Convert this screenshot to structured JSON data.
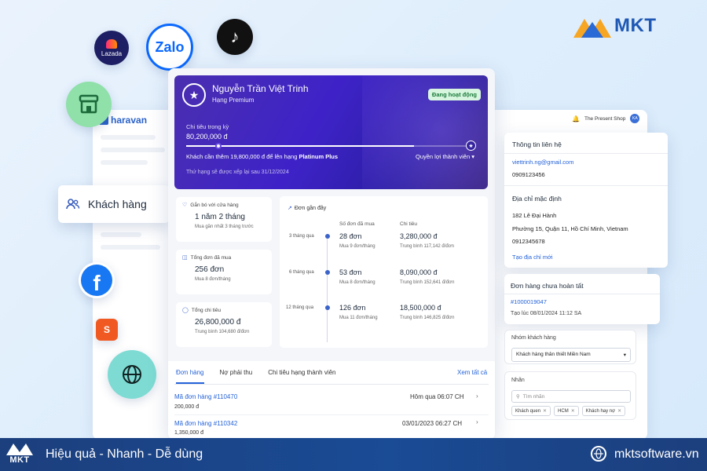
{
  "brand": {
    "top_logo_text": "MKT",
    "footer_logo_text": "MKT",
    "footer_slogan": "Hiệu quả - Nhanh - Dễ dùng",
    "footer_website": "mktsoftware.vn",
    "colors": {
      "primary_blue": "#1f58b4",
      "footer_bg": "#1c3f7d",
      "banner_purple": "#3e22c8",
      "link_blue": "#2563d9"
    }
  },
  "floating_icons": {
    "lazada_label": "Lazada",
    "zalo_label": "Zalo",
    "shopee_label": "Shopee",
    "icon_names": [
      "lazada-icon",
      "zalo-icon",
      "tiktok-icon",
      "store-icon",
      "facebook-icon",
      "shopee-icon",
      "globe-icon"
    ]
  },
  "sidebar_callout": {
    "label": "Khách hàng",
    "icon": "user-group-icon"
  },
  "app": {
    "logo_text": "haravan",
    "shop_name": "The Present Shop",
    "avatar_initials": "KA"
  },
  "profile": {
    "name": "Nguyễn Trần Việt Trinh",
    "tier": "Hạng Premium",
    "status": "Đang hoạt động",
    "spend_label": "Chi tiêu trong kỳ",
    "spend_value": "80,200,000 đ",
    "progress_fraction": 0.8,
    "upgrade_prefix": "Khách cần thêm 19,800,000 đ để lên hạng ",
    "upgrade_tier": "Platinum Plus",
    "benefits_label": "Quyền lợi thành viên",
    "reset_note": "Thứ hạng sẽ được xếp lại sau 31/12/2024"
  },
  "stats": [
    {
      "title": "Gắn bó với cửa hàng",
      "icon": "heart-icon",
      "value": "1 năm 2 tháng",
      "sub": "Mua gần nhất 3 tháng trước"
    },
    {
      "title": "Tổng đơn đã mua",
      "icon": "bag-icon",
      "value": "256 đơn",
      "sub": "Mua 8 đơn/tháng"
    },
    {
      "title": "Tổng chi tiêu",
      "icon": "coin-icon",
      "value": "26,800,000 đ",
      "sub": "Trung bình 104,680 đ/đơn"
    }
  ],
  "recent": {
    "title": "Đơn gần đây",
    "col_orders": "Số đơn đã mua",
    "col_spend": "Chi tiêu",
    "rows": [
      {
        "period": "3 tháng qua",
        "orders": "28 đơn",
        "orders_sub": "Mua 9 đơn/tháng",
        "spend": "3,280,000 đ",
        "spend_sub": "Trung bình 117,142 đ/đơn"
      },
      {
        "period": "6 tháng qua",
        "orders": "53 đơn",
        "orders_sub": "Mua 8 đơn/tháng",
        "spend": "8,090,000 đ",
        "spend_sub": "Trung bình 152,641 đ/đơn"
      },
      {
        "period": "12 tháng qua",
        "orders": "126 đơn",
        "orders_sub": "Mua 11 đơn/tháng",
        "spend": "18,500,000 đ",
        "spend_sub": "Trung bình 146,825 đ/đơn"
      }
    ]
  },
  "order_tabs": {
    "tabs": [
      "Đơn hàng",
      "Nợ phải thu",
      "Chi tiêu hạng thành viên"
    ],
    "active": 0,
    "see_all": "Xem tất cả",
    "orders": [
      {
        "code": "Mã đơn hàng #110470",
        "amount": "200,000 đ",
        "time": "Hôm qua 06:07 CH"
      },
      {
        "code": "Mã đơn hàng #110342",
        "amount": "1,350,000 đ",
        "time": "03/01/2023 06:27 CH"
      }
    ]
  },
  "contact": {
    "title": "Thông tin liên hệ",
    "email": "viettrinh.ng@gmail.com",
    "phone": "0909123456",
    "address_title": "Địa chỉ mặc định",
    "address_line1": "182 Lê Đại Hành",
    "address_line2": "Phường 15, Quận 11, Hồ Chí Minh, Vietnam",
    "address_phone": "0912345678",
    "add_address": "Tạo địa chỉ mới"
  },
  "pending": {
    "title": "Đơn hàng chưa hoàn tất",
    "order_code": "#1000019047",
    "created": "Tạo lúc 08/01/2024 11:12 SA"
  },
  "group": {
    "title": "Nhóm khách hàng",
    "selected": "Khách hàng thân thiết Miền Nam"
  },
  "tags": {
    "title": "Nhãn",
    "search_placeholder": "Tìm nhãn",
    "chips": [
      "Khách quen",
      "HCM",
      "Khách hay nợ"
    ]
  }
}
